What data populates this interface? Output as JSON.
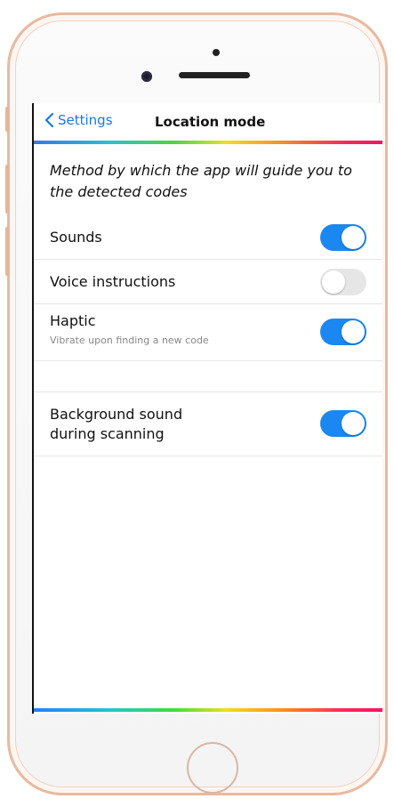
{
  "nav": {
    "back_label": "Settings",
    "title": "Location mode"
  },
  "description": "Method by which the app will guide you to the detected codes",
  "settings": [
    {
      "label": "Sounds",
      "subtitle": "",
      "enabled": true
    },
    {
      "label": "Voice instructions",
      "subtitle": "",
      "enabled": false
    },
    {
      "label": "Haptic",
      "subtitle": "Vibrate upon finding a new code",
      "enabled": true
    },
    {
      "label": "Background sound during scanning",
      "subtitle": "",
      "enabled": true
    }
  ],
  "colors": {
    "accent": "#1a78e6",
    "toggle_on": "#1a88f0",
    "toggle_off": "#e6e6e6",
    "phone_frame": "#e8b9a0"
  },
  "icons": {
    "back": "chevron-left-icon"
  }
}
